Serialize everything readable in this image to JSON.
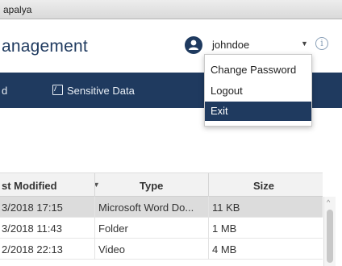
{
  "window": {
    "title": "apalya"
  },
  "header": {
    "app_title": "anagement",
    "username": "johndoe"
  },
  "navbar": {
    "partial_item": "d",
    "sensitive_data": "Sensitive Data"
  },
  "user_menu": {
    "items": [
      "Change Password",
      "Logout",
      "Exit"
    ],
    "highlighted": "Exit"
  },
  "table": {
    "columns": [
      "st Modified",
      "Type",
      "Size"
    ],
    "sort_column": "st Modified",
    "rows": [
      {
        "modified": "3/2018 17:15",
        "type": "Microsoft Word Do...",
        "size": "11 KB"
      },
      {
        "modified": "3/2018 11:43",
        "type": "Folder",
        "size": "1 MB"
      },
      {
        "modified": "2/2018 22:13",
        "type": "Video",
        "size": "4 MB"
      }
    ]
  },
  "colors": {
    "primary": "#1f3a5f",
    "selected_row": "#dcdcdc"
  },
  "icons": {
    "user": "user-avatar-icon",
    "chevron": "chevron-down-icon",
    "info": "info-icon",
    "sensitive": "external-link-icon",
    "sort": "sort-down-icon",
    "scroll": "scroll-up-icon"
  }
}
